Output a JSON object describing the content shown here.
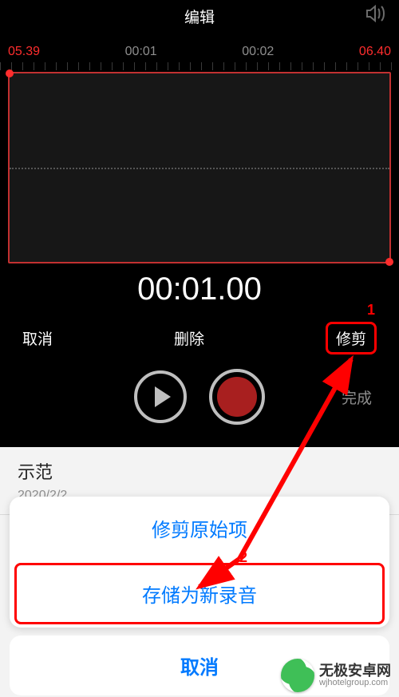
{
  "header": {
    "title": "编辑"
  },
  "timeline": {
    "left_mark": "05.39",
    "tick1": "00:01",
    "tick2": "00:02",
    "right_mark": "06.40"
  },
  "timer": "00:01.00",
  "actions": {
    "cancel": "取消",
    "delete": "删除",
    "trim": "修剪",
    "done": "完成"
  },
  "list": {
    "item1_name": "示范",
    "item1_sub": "2020/2/2"
  },
  "sheet": {
    "trim_original": "修剪原始项",
    "save_as_new": "存储为新录音",
    "cancel": "取消"
  },
  "annotations": {
    "n1": "1",
    "n2": "2"
  },
  "watermark": {
    "brand": "无极安卓网",
    "domain": "wjhotelgroup.com"
  }
}
